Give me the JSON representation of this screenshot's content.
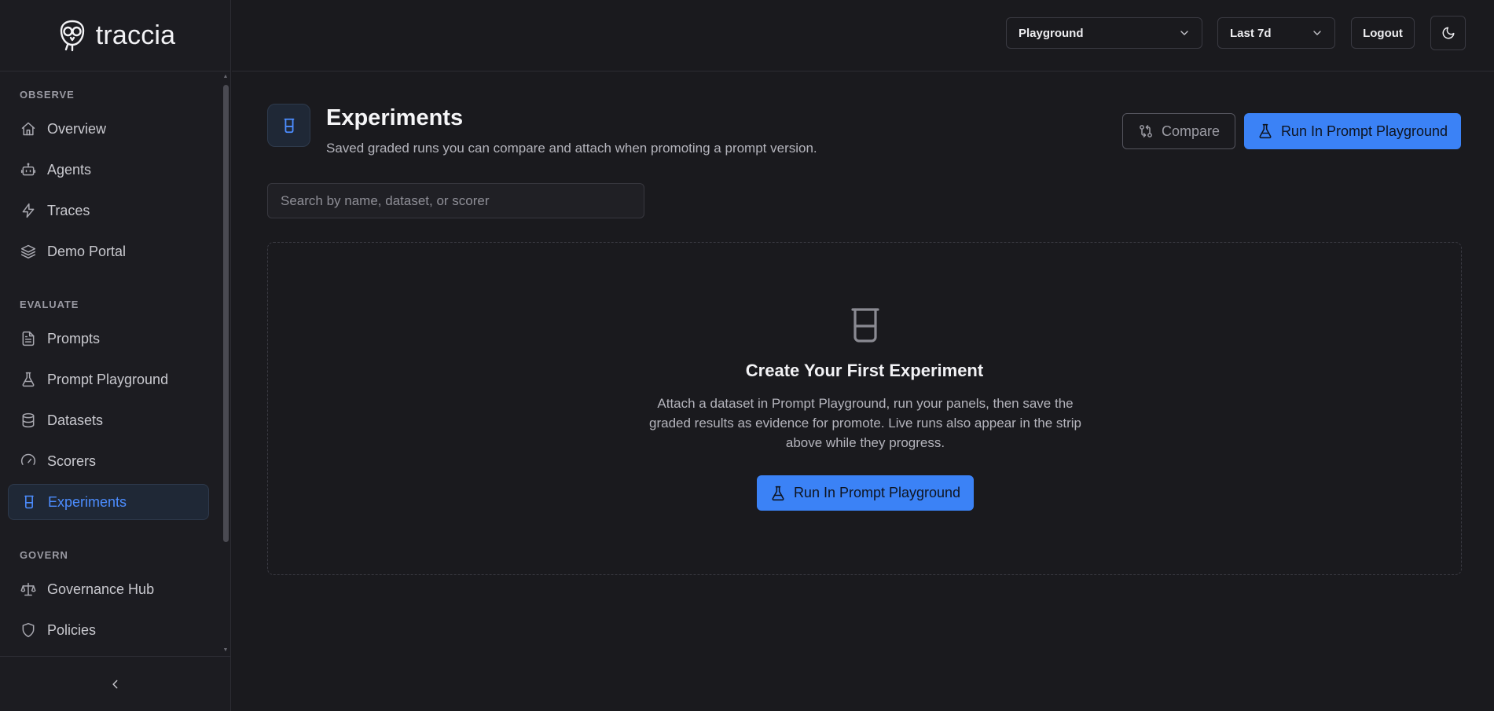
{
  "brand": {
    "name": "traccia"
  },
  "sidebar": {
    "sections": [
      {
        "label": "OBSERVE"
      },
      {
        "label": "EVALUATE"
      },
      {
        "label": "GOVERN"
      }
    ],
    "items": [
      {
        "label": "Overview",
        "icon": "home-icon"
      },
      {
        "label": "Agents",
        "icon": "bot-icon"
      },
      {
        "label": "Traces",
        "icon": "zap-icon"
      },
      {
        "label": "Demo Portal",
        "icon": "layers-icon"
      },
      {
        "label": "Prompts",
        "icon": "file-text-icon"
      },
      {
        "label": "Prompt Playground",
        "icon": "flask-icon"
      },
      {
        "label": "Datasets",
        "icon": "database-icon"
      },
      {
        "label": "Scorers",
        "icon": "gauge-icon"
      },
      {
        "label": "Experiments",
        "icon": "beaker-icon",
        "active": true
      },
      {
        "label": "Governance Hub",
        "icon": "scale-icon"
      },
      {
        "label": "Policies",
        "icon": "shield-icon"
      }
    ]
  },
  "topbar": {
    "project_select": "Playground",
    "range_select": "Last 7d",
    "logout_label": "Logout",
    "theme_icon": "moon-icon"
  },
  "main": {
    "title": "Experiments",
    "subtitle": "Saved graded runs you can compare and attach when promoting a prompt version.",
    "compare_label": "Compare",
    "run_label": "Run In Prompt Playground",
    "search_placeholder": "Search by name, dataset, or scorer",
    "empty": {
      "title": "Create Your First Experiment",
      "text": "Attach a dataset in Prompt Playground, run your panels, then save the graded results as evidence for promote. Live runs also appear in the strip above while they progress.",
      "button_label": "Run In Prompt Playground"
    }
  },
  "colors": {
    "accent": "#3b82f6",
    "active_text": "#4c8dff",
    "background": "#1a1a1e",
    "sidebar_bg": "#1c1c21"
  }
}
